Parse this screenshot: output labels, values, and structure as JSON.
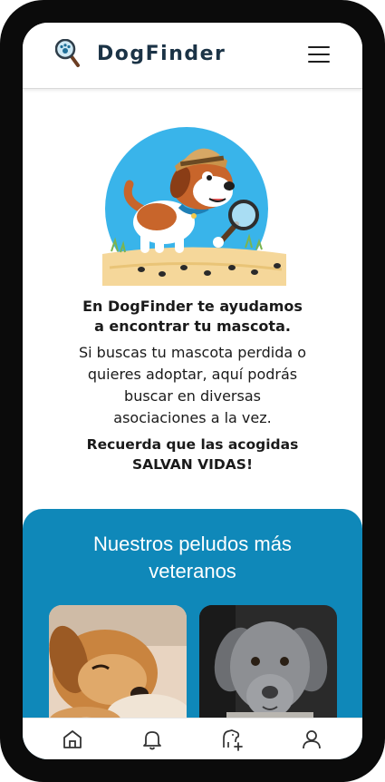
{
  "header": {
    "brand": "DogFinder"
  },
  "intro": {
    "headline_line1": "En DogFinder te ayudamos",
    "headline_line2": "a encontrar tu mascota.",
    "body_line1": "Si buscas tu mascota perdida o",
    "body_line2": "quieres adoptar, aquí podrás",
    "body_line3": "buscar en diversas",
    "body_line4": "asociaciones a la vez.",
    "cta_line1": "Recuerda que las acogidas",
    "cta_line2": "SALVAN VIDAS!"
  },
  "veterans": {
    "title_line1": "Nuestros peludos más",
    "title_line2": "veteranos",
    "background_color": "#0f88b9"
  },
  "bottom_nav": {
    "items": [
      {
        "icon": "home-icon"
      },
      {
        "icon": "bell-icon"
      },
      {
        "icon": "add-pet-icon"
      },
      {
        "icon": "user-icon"
      }
    ]
  },
  "colors": {
    "brand_text": "#1b3346",
    "accent_blue": "#0f88b9"
  }
}
